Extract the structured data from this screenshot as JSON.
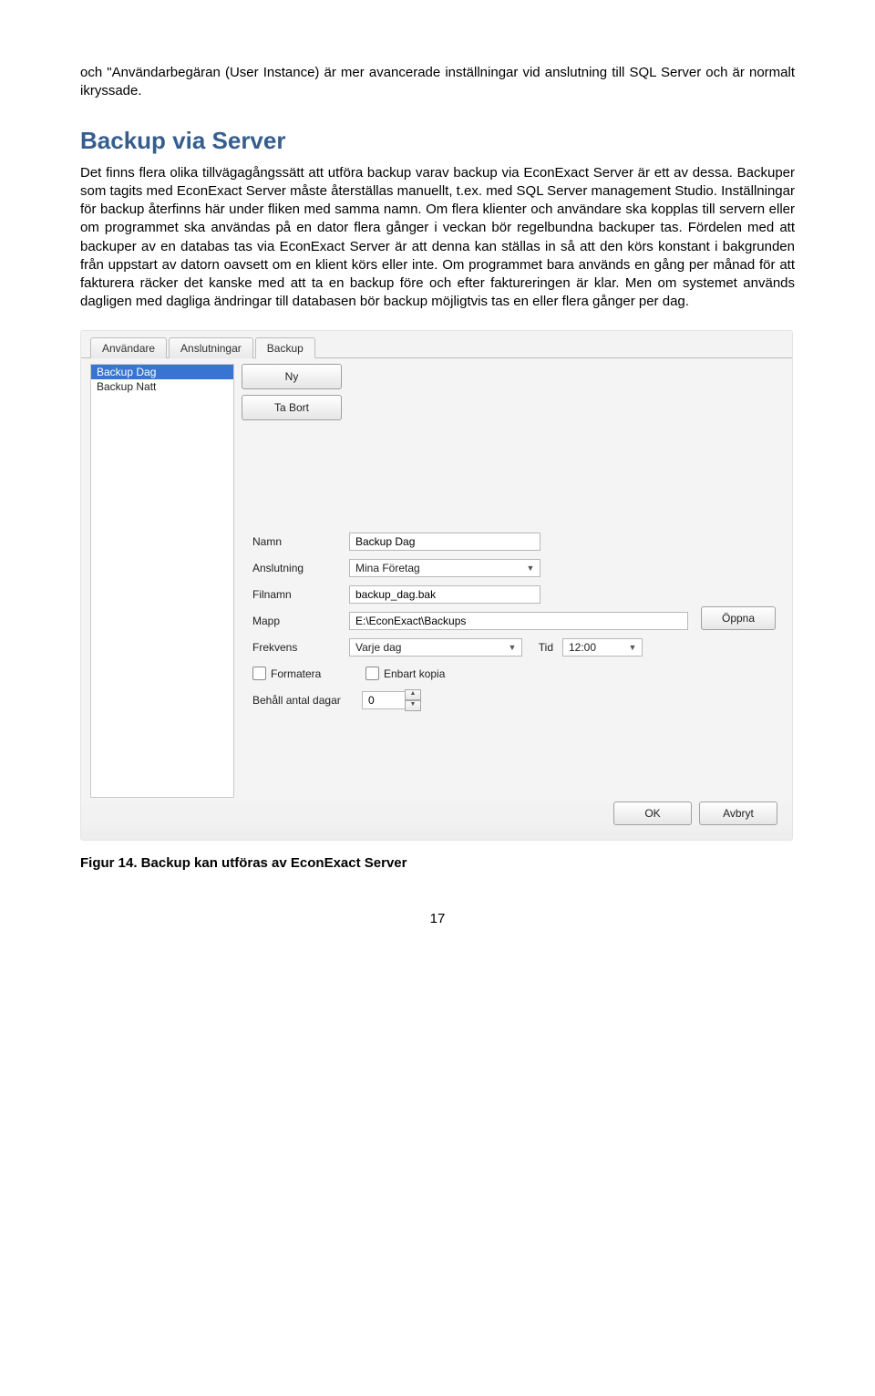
{
  "para1": "och \"Användarbegäran (User Instance) är mer avancerade inställningar vid anslutning till SQL Server och är normalt ikryssade.",
  "h2": "Backup via Server",
  "para2": "Det finns flera olika tillvägagångssätt att utföra backup varav backup via EconExact Server är ett av dessa. Backuper som tagits med EconExact Server måste återställas manuellt, t.ex. med SQL Server management Studio. Inställningar för backup återfinns här under fliken med samma namn. Om flera klienter och användare ska kopplas till servern eller om programmet ska användas på en dator flera gånger i veckan bör regelbundna backuper tas. Fördelen med att backuper av en databas tas via EconExact Server är att denna kan ställas in så att den körs konstant i bakgrunden från uppstart av datorn oavsett om en klient körs eller inte. Om programmet bara används en gång per månad för att fakturera räcker det kanske med att ta en backup före och efter faktureringen är klar. Men om systemet används dagligen med dagliga ändringar till databasen bör backup möjligtvis tas en eller flera gånger per dag.",
  "ui": {
    "tabs": [
      "Användare",
      "Anslutningar",
      "Backup"
    ],
    "sidebar": [
      "Backup Dag",
      "Backup Natt"
    ],
    "buttons": {
      "new": "Ny",
      "delete": "Ta Bort",
      "open": "Öppna",
      "ok": "OK",
      "cancel": "Avbryt"
    },
    "labels": {
      "name": "Namn",
      "connection": "Anslutning",
      "filename": "Filnamn",
      "folder": "Mapp",
      "frequency": "Frekvens",
      "time": "Tid",
      "format": "Formatera",
      "copyonly": "Enbart kopia",
      "keepdays": "Behåll antal dagar"
    },
    "values": {
      "name": "Backup Dag",
      "connection": "Mina Företag",
      "filename": "backup_dag.bak",
      "folder": "E:\\EconExact\\Backups",
      "frequency": "Varje dag",
      "time": "12:00",
      "keepdays": "0"
    }
  },
  "figcaption": "Figur 14. Backup kan utföras av EconExact Server",
  "pagenum": "17"
}
